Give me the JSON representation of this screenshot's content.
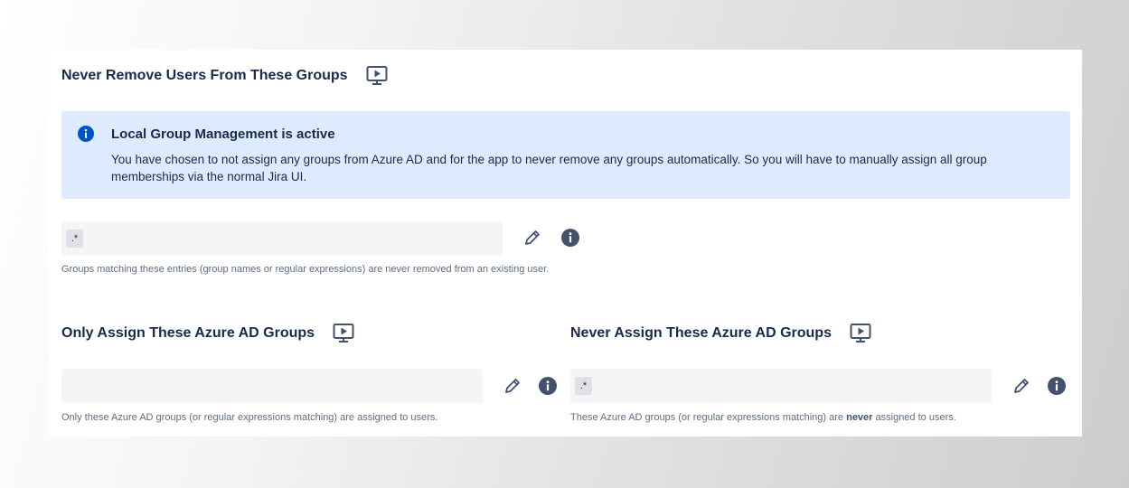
{
  "never_remove": {
    "heading": "Never Remove Users From These Groups",
    "banner": {
      "title": "Local Group Management is active",
      "text": "You have chosen to not assign any groups from Azure AD and for the app to never remove any groups automatically. So you will have to manually assign all group memberships via the normal Jira UI."
    },
    "field_tag": ".*",
    "help": "Groups matching these entries (group names or regular expressions) are never removed from an existing user."
  },
  "only_assign": {
    "heading": "Only Assign These Azure AD Groups",
    "help": "Only these Azure AD groups (or regular expressions matching) are assigned to users."
  },
  "never_assign": {
    "heading": "Never Assign These Azure AD Groups",
    "field_tag": ".*",
    "help_prefix": "These Azure AD groups (or regular expressions matching) are ",
    "help_emphasis": "never",
    "help_suffix": " assigned to users."
  },
  "colors": {
    "banner_bg": "#deebff",
    "info_blue": "#0052cc",
    "icon_dark": "#42526e",
    "field_bg": "#f4f5f7"
  },
  "icons": {
    "heading_icon": "video-play-icon",
    "banner_icon": "info-icon",
    "edit_icon": "pencil-icon",
    "help_icon": "info-icon"
  }
}
